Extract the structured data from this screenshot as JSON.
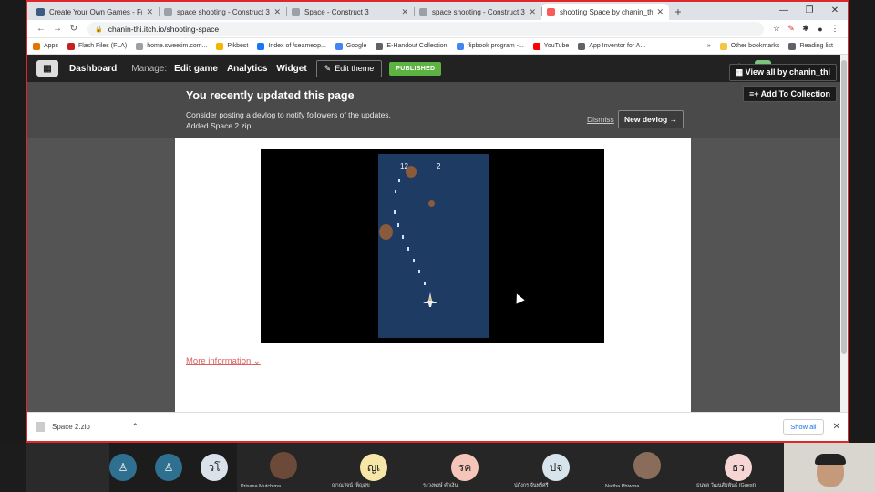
{
  "browser": {
    "tabs": [
      {
        "title": "Create Your Own Games - Free T",
        "color": "#3d5a80",
        "active": false
      },
      {
        "title": "space shooting - Construct 3",
        "color": "#9aa0a6",
        "active": false
      },
      {
        "title": "Space - Construct 3",
        "color": "#9aa0a6",
        "active": false
      },
      {
        "title": "space shooting - Construct 3",
        "color": "#9aa0a6",
        "active": false
      },
      {
        "title": "shooting Space by chanin_thi",
        "color": "#fa5c5c",
        "active": true
      }
    ],
    "tab_close": "✕",
    "new_tab": "+",
    "window_controls": [
      "—",
      "❐",
      "✕"
    ],
    "url": "chanin-thi.itch.io/shooting-space",
    "bookmarks": [
      {
        "label": "Apps",
        "color": "#e37400"
      },
      {
        "label": "Flash Files (FLA)",
        "color": "#c5221f"
      },
      {
        "label": "home.sweetim.com...",
        "color": "#9aa0a6"
      },
      {
        "label": "Pikbest",
        "color": "#f4b400"
      },
      {
        "label": "Index of /seameop...",
        "color": "#1877f2"
      },
      {
        "label": "Google",
        "color": "#4285f4"
      },
      {
        "label": "E-Handout Collection",
        "color": "#5f6368"
      },
      {
        "label": "flipbook program -...",
        "color": "#4285f4"
      },
      {
        "label": "YouTube",
        "color": "#ff0000"
      },
      {
        "label": "App Inventor for A...",
        "color": "#5f6368"
      }
    ],
    "bookmarks_more": "»",
    "other_bookmarks": "Other bookmarks",
    "reading_list": "Reading list"
  },
  "itch_header": {
    "dashboard": "Dashboard",
    "manage": "Manage:",
    "edit_game": "Edit game",
    "analytics": "Analytics",
    "widget": "Widget",
    "edit_theme": "Edit theme",
    "published": "PUBLISHED",
    "username": "chanin_thi"
  },
  "notice": {
    "title": "You recently updated this page",
    "line1": "Consider posting a devlog to notify followers of the updates.",
    "line2": "Added Space 2.zip",
    "dismiss": "Dismiss",
    "new_devlog": "New devlog →",
    "view_all": "View all by chanin_thi",
    "add_collection": "Add To Collection"
  },
  "game": {
    "score_left": "12",
    "score_right": "2"
  },
  "more_information": "More information",
  "downloads": {
    "file": "Space 2.zip",
    "show_all": "Show all"
  },
  "meeting": {
    "participants": [
      {
        "initials": "",
        "name": "",
        "color": "#2f6f8f"
      },
      {
        "initials": "",
        "name": "",
        "color": "#2f6f8f"
      },
      {
        "initials": "วโ",
        "name": "",
        "color": "#d9e1ea"
      },
      {
        "initials": "",
        "name": "Prisana Mutchima",
        "photo": true
      },
      {
        "initials": "ญเ",
        "name": "ญาณวัจน์ เพ็ญสุข",
        "color": "#f6e7a8"
      },
      {
        "initials": "รค",
        "name": "ระวงพงษ์ คำเงิน",
        "color": "#f4c5b8"
      },
      {
        "initials": "ปจ",
        "name": "ปภังกร จันทร์ศรี",
        "color": "#d8e4ec"
      },
      {
        "initials": "",
        "name": "Nattha Phiwma",
        "photo": true
      },
      {
        "initials": "ธว",
        "name": "ธนพล วัฒนสัมพันธ์ (Guest)",
        "color": "#f6d5d5"
      }
    ]
  }
}
